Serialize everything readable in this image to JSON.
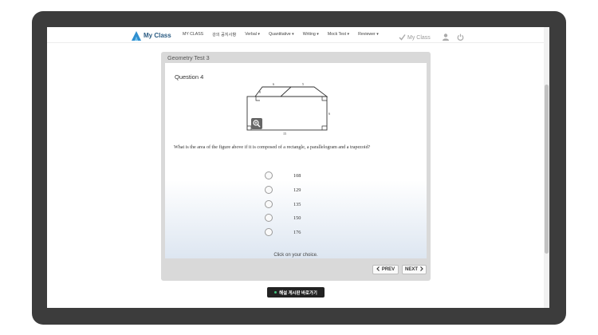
{
  "nav": {
    "logo_text": "My Class",
    "menu": [
      {
        "label": "MY CLASS"
      },
      {
        "label": "강의 공지사항"
      },
      {
        "label": "Verbal ▾"
      },
      {
        "label": "Quantitative ▾"
      },
      {
        "label": "Writing ▾"
      },
      {
        "label": "Mock Test ▾"
      },
      {
        "label": "Reviewer ▾"
      }
    ],
    "my_class_label": "My Class",
    "icons": [
      "check-icon",
      "user-icon",
      "power-icon"
    ]
  },
  "quiz": {
    "title": "Geometry Test 3",
    "question_label": "Question 4",
    "figure_labels": {
      "top_left": "6",
      "top_right": "5",
      "slant": "8",
      "right": "6",
      "bottom": "15"
    },
    "question_text": "What is the area of the figure above if it is composed of a rectangle, a parallelogram and a trapezoid?",
    "choices": [
      {
        "label": "108"
      },
      {
        "label": "129"
      },
      {
        "label": "135"
      },
      {
        "label": "150"
      },
      {
        "label": "176"
      }
    ],
    "hint": "Click on your choice.",
    "prev_label": "PREV",
    "next_label": "NEXT"
  },
  "board_button_label": "해설 게시판 바로가기",
  "colors": {
    "device": "#3c3c3c",
    "logo": "#2a5b82",
    "accent_dot": "#3fc07a"
  }
}
